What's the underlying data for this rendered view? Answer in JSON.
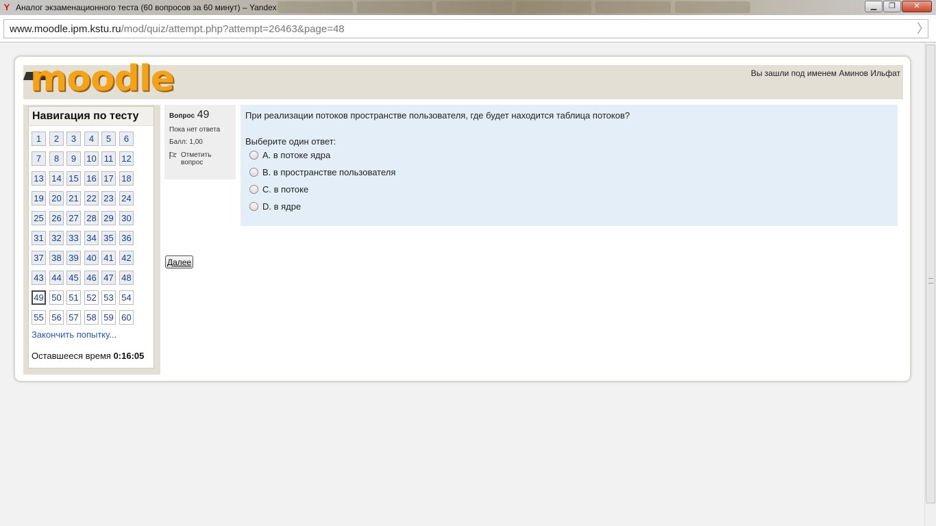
{
  "browser": {
    "window_title": "Аналог экзаменационного теста (60 вопросов за 60 минут) – Yandex",
    "url_host": "www.moodle.ipm.kstu.ru",
    "url_path": "/mod/quiz/attempt.php?attempt=26463&page=48",
    "controls": {
      "minimize": "▁",
      "maximize": "❐",
      "close": "✕"
    }
  },
  "header": {
    "logo_text": "moodle",
    "login_info": "Вы зашли под именем Аминов Ильфат"
  },
  "navigation": {
    "title": "Навигация по тесту",
    "questions": [
      "1",
      "2",
      "3",
      "4",
      "5",
      "6",
      "7",
      "8",
      "9",
      "10",
      "11",
      "12",
      "13",
      "14",
      "15",
      "16",
      "17",
      "18",
      "19",
      "20",
      "21",
      "22",
      "23",
      "24",
      "25",
      "26",
      "27",
      "28",
      "29",
      "30",
      "31",
      "32",
      "33",
      "34",
      "35",
      "36",
      "37",
      "38",
      "39",
      "40",
      "41",
      "42",
      "43",
      "44",
      "45",
      "46",
      "47",
      "48",
      "49",
      "50",
      "51",
      "52",
      "53",
      "54",
      "55",
      "56",
      "57",
      "58",
      "59",
      "60"
    ],
    "answered_count": 48,
    "current": "49",
    "finish_link": "Закончить попытку...",
    "timer_label": "Оставшееся время",
    "timer_value": "0:16:05"
  },
  "question_info": {
    "label": "Вопрос",
    "number": "49",
    "state": "Пока нет ответа",
    "grade": "Балл: 1,00",
    "flag_label": "Отметить вопрос"
  },
  "question": {
    "text": "При реализации потоков пространстве пользователя, где будет находится таблица потоков?",
    "prompt": "Выберите один ответ:",
    "answers": [
      "A. в потоке ядра",
      "B. в пространстве пользователя",
      "C. в потоке",
      "D. в ядре"
    ]
  },
  "buttons": {
    "next": "Далее"
  }
}
